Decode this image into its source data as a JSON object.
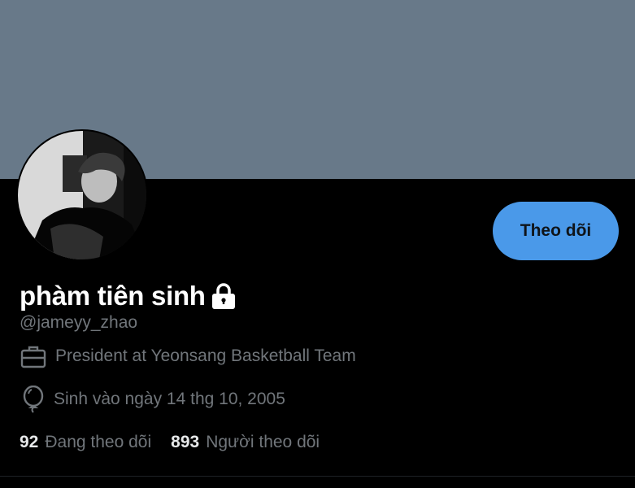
{
  "profile": {
    "display_name": "phàm tiên sinh",
    "handle": "@jameyy_zhao",
    "job": "President at Yeonsang Basketball Team",
    "birthday": "Sinh vào ngày 14 thg 10, 2005"
  },
  "actions": {
    "follow_label": "Theo dõi"
  },
  "stats": {
    "following_count": "92",
    "following_label": "Đang theo dõi",
    "followers_count": "893",
    "followers_label": "Người theo dõi"
  },
  "colors": {
    "banner": "#687989",
    "background": "#000000",
    "accent_button": "#4a99e9",
    "secondary_text": "#71767b"
  },
  "icons": {
    "lock": "lock-icon",
    "briefcase": "briefcase-icon",
    "balloon": "balloon-icon"
  }
}
